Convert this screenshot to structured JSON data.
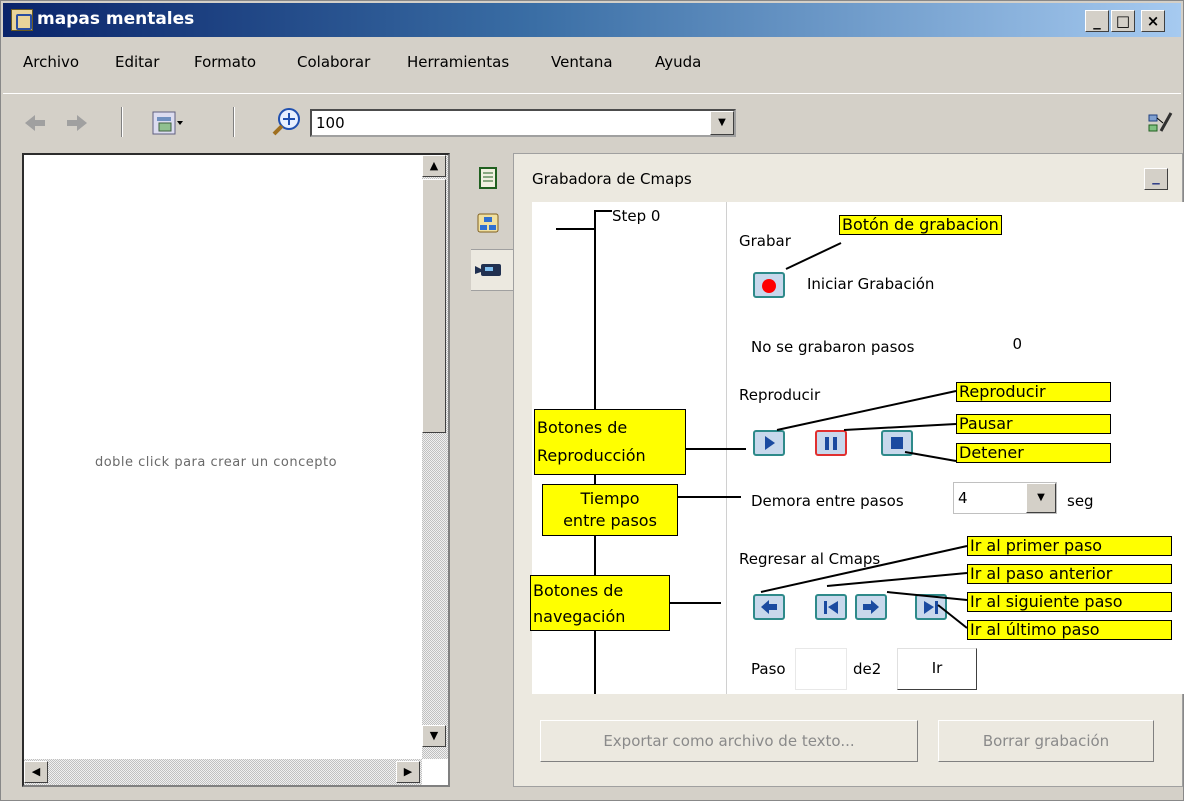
{
  "window": {
    "title": "mapas mentales",
    "min": "_",
    "max": "□",
    "close": "×"
  },
  "menu": [
    "Archivo",
    "Editar",
    "Formato",
    "Colaborar",
    "Herramientas",
    "Ventana",
    "Ayuda"
  ],
  "toolbar": {
    "zoom_value": "100"
  },
  "canvas": {
    "hint": "doble click para crear un concepto"
  },
  "recorder": {
    "title": "Grabadora de Cmaps",
    "step_label": "Step 0",
    "record_section": "Grabar",
    "start_recording": "Iniciar Grabación",
    "no_steps_label": "No se grabaron pasos",
    "no_steps_count": "0",
    "play_section": "Reproducir",
    "delay_label": "Demora entre pasos",
    "delay_value": "4",
    "delay_unit": "seg",
    "return_section": "Regresar al  Cmaps",
    "step_field_label": "Paso",
    "step_of": "de2",
    "go_button": "Ir",
    "export_button": "Exportar como archivo de texto...",
    "clear_button": "Borrar grabación"
  },
  "callouts": {
    "record_button": "Botón de grabacion",
    "play": "Reproducir",
    "pause": "Pausar",
    "stop": "Detener",
    "playback_buttons": [
      "Botones de",
      "Reproducción"
    ],
    "step_time": [
      "Tiempo",
      "entre pasos"
    ],
    "nav_buttons": [
      "Botones de",
      "navegación"
    ],
    "first_step": "Ir al primer paso",
    "prev_step": "Ir al paso anterior",
    "next_step": "Ir al siguiente paso",
    "last_step": "Ir al último paso"
  },
  "colors": {
    "callout": "#ffff00",
    "record_dot": "#ff0000",
    "button_border": "#2e8a8a",
    "pause_border": "#e03030"
  }
}
